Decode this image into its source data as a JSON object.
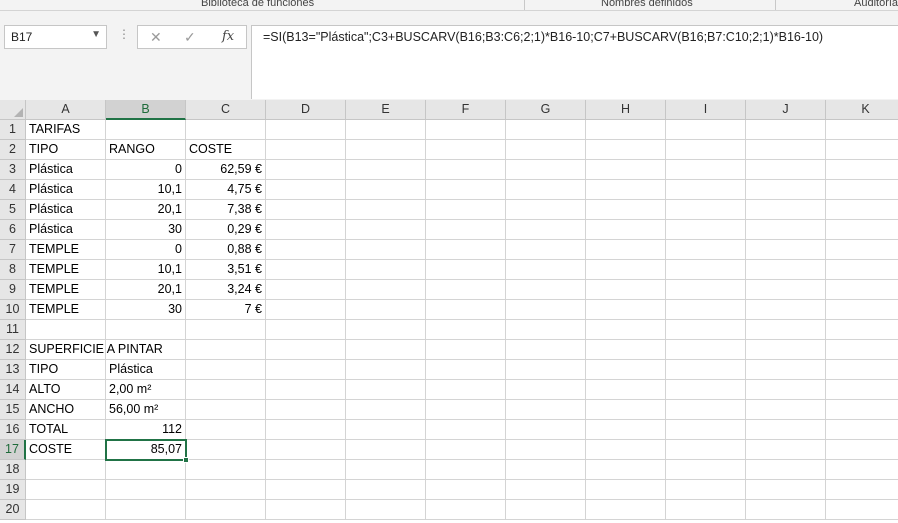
{
  "ribbon": {
    "groups": [
      "Biblioteca de funciones",
      "Nombres definidos",
      "Auditoría"
    ]
  },
  "formula_bar": {
    "name_box": "B17",
    "cancel_icon": "close-icon",
    "enter_icon": "check-icon",
    "fx_label": "fx",
    "formula": "=SI(B13=\"Plástica\";C3+BUSCARV(B16;B3:C6;2;1)*B16-10;C7+BUSCARV(B16;B7:C10;2;1)*B16-10)"
  },
  "sheet": {
    "columns": [
      "A",
      "B",
      "C",
      "D",
      "E",
      "F",
      "G",
      "H",
      "I",
      "J",
      "K"
    ],
    "selected_column": "B",
    "selected_row": "17",
    "active_cell": "B17",
    "rows": [
      {
        "n": "1",
        "cells": [
          {
            "v": "TARIFAS",
            "a": "l"
          },
          {
            "v": ""
          },
          {
            "v": ""
          }
        ]
      },
      {
        "n": "2",
        "cells": [
          {
            "v": "TIPO",
            "a": "l"
          },
          {
            "v": "RANGO",
            "a": "l"
          },
          {
            "v": "COSTE",
            "a": "l"
          }
        ]
      },
      {
        "n": "3",
        "cells": [
          {
            "v": "Plástica",
            "a": "l"
          },
          {
            "v": "0",
            "a": "r"
          },
          {
            "v": "62,59 €",
            "a": "r"
          }
        ]
      },
      {
        "n": "4",
        "cells": [
          {
            "v": "Plástica",
            "a": "l"
          },
          {
            "v": "10,1",
            "a": "r"
          },
          {
            "v": "4,75 € ",
            "a": "r"
          }
        ]
      },
      {
        "n": "5",
        "cells": [
          {
            "v": "Plástica",
            "a": "l"
          },
          {
            "v": "20,1",
            "a": "r"
          },
          {
            "v": "7,38 € ",
            "a": "r"
          }
        ]
      },
      {
        "n": "6",
        "cells": [
          {
            "v": "Plástica",
            "a": "l"
          },
          {
            "v": "30",
            "a": "r"
          },
          {
            "v": "0,29 €",
            "a": "r"
          }
        ]
      },
      {
        "n": "7",
        "cells": [
          {
            "v": "TEMPLE",
            "a": "l"
          },
          {
            "v": "0",
            "a": "r"
          },
          {
            "v": "0,88 €",
            "a": "r"
          }
        ]
      },
      {
        "n": "8",
        "cells": [
          {
            "v": "TEMPLE",
            "a": "l"
          },
          {
            "v": "10,1",
            "a": "r"
          },
          {
            "v": "3,51 €",
            "a": "r"
          }
        ]
      },
      {
        "n": "9",
        "cells": [
          {
            "v": "TEMPLE",
            "a": "l"
          },
          {
            "v": "20,1",
            "a": "r"
          },
          {
            "v": "3,24 €",
            "a": "r"
          }
        ]
      },
      {
        "n": "10",
        "cells": [
          {
            "v": "TEMPLE",
            "a": "l"
          },
          {
            "v": "30",
            "a": "r"
          },
          {
            "v": "7 €",
            "a": "r"
          }
        ]
      },
      {
        "n": "11",
        "cells": [
          {
            "v": ""
          },
          {
            "v": ""
          },
          {
            "v": ""
          }
        ]
      },
      {
        "n": "12",
        "cells": [
          {
            "v": "SUPERFICIE A PINTAR",
            "a": "l",
            "overflow": true
          },
          {
            "v": ""
          },
          {
            "v": ""
          }
        ]
      },
      {
        "n": "13",
        "cells": [
          {
            "v": "TIPO",
            "a": "l"
          },
          {
            "v": "Plástica",
            "a": "l"
          },
          {
            "v": ""
          }
        ]
      },
      {
        "n": "14",
        "cells": [
          {
            "v": "ALTO",
            "a": "l"
          },
          {
            "v": "2,00 m²",
            "a": "l"
          },
          {
            "v": ""
          }
        ]
      },
      {
        "n": "15",
        "cells": [
          {
            "v": "ANCHO",
            "a": "l"
          },
          {
            "v": "56,00 m²",
            "a": "l"
          },
          {
            "v": ""
          }
        ]
      },
      {
        "n": "16",
        "cells": [
          {
            "v": "TOTAL",
            "a": "l"
          },
          {
            "v": "112",
            "a": "r"
          },
          {
            "v": ""
          }
        ]
      },
      {
        "n": "17",
        "cells": [
          {
            "v": "COSTE",
            "a": "l"
          },
          {
            "v": "85,07",
            "a": "r"
          },
          {
            "v": ""
          }
        ]
      },
      {
        "n": "18",
        "cells": [
          {
            "v": ""
          },
          {
            "v": ""
          },
          {
            "v": ""
          }
        ]
      },
      {
        "n": "19",
        "cells": [
          {
            "v": ""
          },
          {
            "v": ""
          },
          {
            "v": ""
          }
        ]
      },
      {
        "n": "20",
        "cells": [
          {
            "v": ""
          },
          {
            "v": ""
          },
          {
            "v": ""
          }
        ]
      }
    ]
  },
  "colors": {
    "accent": "#217346",
    "header_bg": "#e6e6e6",
    "gridline": "#d4d4d4"
  }
}
